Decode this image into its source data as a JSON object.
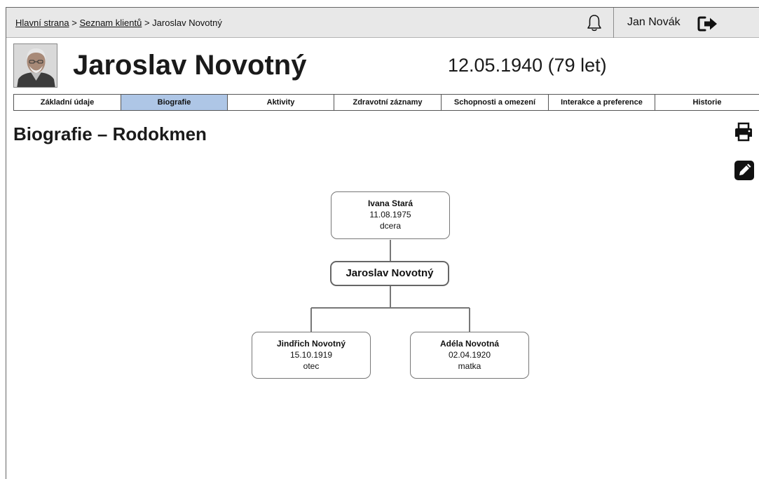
{
  "breadcrumb": {
    "items": [
      "Hlavní strana",
      "Seznam klientů",
      "Jaroslav Novotný"
    ],
    "separator": ">"
  },
  "header": {
    "user_name": "Jan Novák",
    "client_name": "Jaroslav Novotný",
    "birth_info": "12.05.1940 (79 let)"
  },
  "tabs": [
    {
      "label": "Základní údaje",
      "active": false
    },
    {
      "label": "Biografie",
      "active": true
    },
    {
      "label": "Aktivity",
      "active": false
    },
    {
      "label": "Zdravotní záznamy",
      "active": false
    },
    {
      "label": "Schopnosti a omezení",
      "active": false
    },
    {
      "label": "Interakce a preference",
      "active": false
    },
    {
      "label": "Historie",
      "active": false
    }
  ],
  "section": {
    "title": "Biografie – Rodokmen"
  },
  "icons": {
    "notifications": "bell-icon",
    "logout": "logout-icon",
    "print": "printer-icon",
    "edit": "pencil-icon"
  },
  "colors": {
    "active_tab": "#aec6e6",
    "topbar": "#e8e8e8",
    "tree_line": "#777777"
  },
  "family_tree": {
    "daughter": {
      "name": "Ivana Stará",
      "date": "11.08.1975",
      "role": "dcera"
    },
    "self": {
      "name": "Jaroslav Novotný"
    },
    "father": {
      "name": "Jindřich Novotný",
      "date": "15.10.1919",
      "role": "otec"
    },
    "mother": {
      "name": "Adéla Novotná",
      "date": "02.04.1920",
      "role": "matka"
    }
  }
}
